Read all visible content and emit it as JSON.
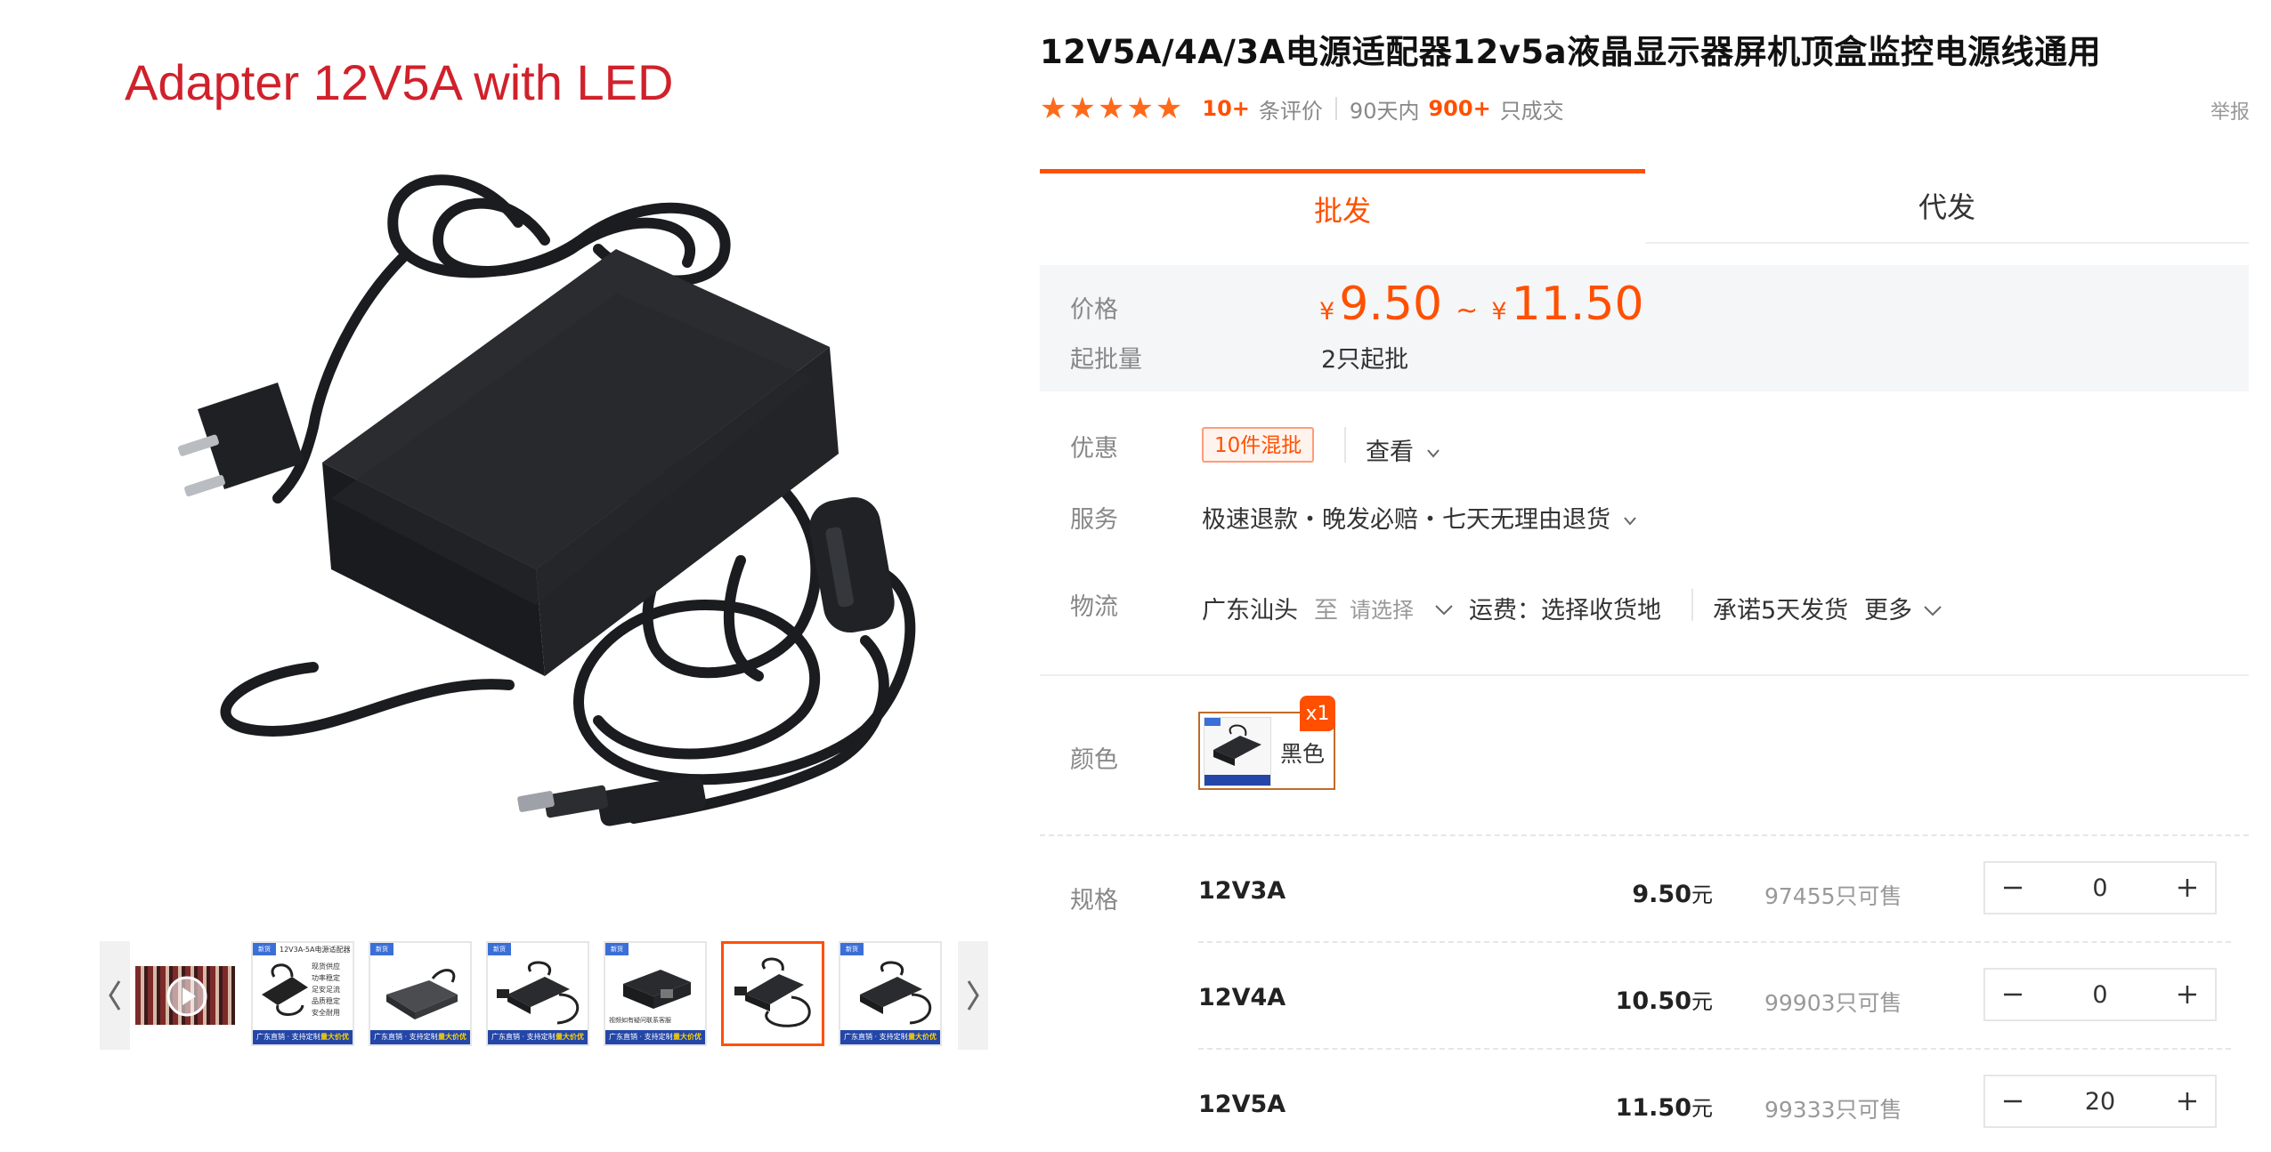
{
  "image": {
    "caption": "Adapter 12V5A with LED"
  },
  "thumbnails": [
    {
      "kind": "video"
    },
    {
      "kind": "poster",
      "corner": "新货",
      "banner": "12V3A-5A电源适配器",
      "lines": [
        "现货供应",
        "功率稳定",
        "足安足流",
        "品质稳定",
        "安全耐用"
      ],
      "tag": "广东直销 · 支持定制",
      "tag_bold": "量大价优"
    },
    {
      "kind": "photo",
      "corner": "新货",
      "tag": "广东直销 · 支持定制",
      "tag_bold": "量大价优"
    },
    {
      "kind": "photo",
      "corner": "新货",
      "tag": "广东直销 · 支持定制",
      "tag_bold": "量大价优"
    },
    {
      "kind": "photo",
      "corner": "新货",
      "top": "视频如有疑问联系客服",
      "tag": "广东直销 · 支持定制",
      "tag_bold": "量大价优"
    },
    {
      "kind": "photo",
      "active": true
    },
    {
      "kind": "photo",
      "corner": "新货",
      "tag": "广东直销 · 支持定制",
      "tag_bold": "量大价优"
    }
  ],
  "product": {
    "title": "12V5A/4A/3A电源适配器12v5a液晶显示器屏机顶盒监控电源线通用",
    "stars": "★★★★★",
    "review_count": "10+",
    "review_label": "条评价",
    "period_label": "90天内",
    "sold_count": "900+",
    "sold_label": "只成交",
    "report_label": "举报"
  },
  "tabs": [
    {
      "label": "批发",
      "active": true
    },
    {
      "label": "代发",
      "active": false
    }
  ],
  "price": {
    "label": "价格",
    "currency": "¥",
    "min": "9.50",
    "tilde": "~",
    "max": "11.50",
    "moq_label": "起批量",
    "moq_value": "2只起批"
  },
  "promo": {
    "label": "优惠",
    "badge": "10件混批",
    "view_label": "查看"
  },
  "service": {
    "label": "服务",
    "text": "极速退款・晚发必赔・七天无理由退货"
  },
  "logistics": {
    "label": "物流",
    "origin": "广东汕头",
    "to": "至",
    "select": "请选择",
    "shipping": "运费：选择收货地",
    "promise": "承诺5天发货",
    "more": "更多"
  },
  "color": {
    "label": "颜色",
    "option": "黑色",
    "count_badge": "x1"
  },
  "spec": {
    "label": "规格",
    "unit": "元",
    "stock_suffix": "只可售",
    "rows": [
      {
        "name": "12V3A",
        "price": "9.50",
        "stock": "97455",
        "qty": "0"
      },
      {
        "name": "12V4A",
        "price": "10.50",
        "stock": "99903",
        "qty": "0"
      },
      {
        "name": "12V5A",
        "price": "11.50",
        "stock": "99333",
        "qty": "20"
      }
    ]
  },
  "colors": {
    "accent": "#ff5000",
    "caption_red": "#d0212b",
    "star": "#ff6a1a"
  }
}
